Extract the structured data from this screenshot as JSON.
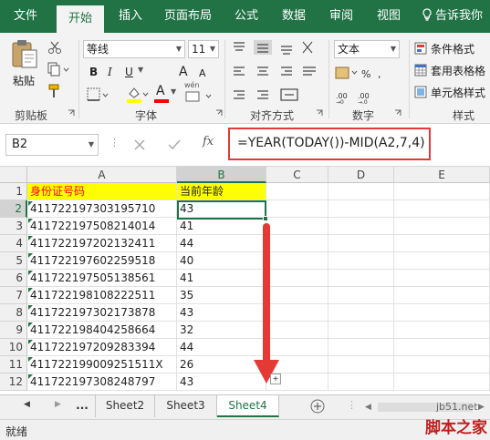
{
  "menu": {
    "tabs": [
      "文件",
      "开始",
      "插入",
      "页面布局",
      "公式",
      "数据",
      "审阅",
      "视图"
    ],
    "active": "开始",
    "tell_me": "告诉我你"
  },
  "ribbon": {
    "clipboard": {
      "paste": "粘贴",
      "label": "剪贴板"
    },
    "font": {
      "name": "等线",
      "size": "11",
      "bold": "B",
      "italic": "I",
      "underline": "U",
      "grow": "A",
      "shrink": "A",
      "color_letter": "A",
      "wen": "wén",
      "label": "字体"
    },
    "alignment": {
      "label": "对齐方式"
    },
    "number": {
      "format": "文本",
      "label": "数字"
    },
    "styles": {
      "cond_format": "条件格式",
      "table_format": "套用表格格",
      "cell_style": "单元格样式",
      "label": "样式"
    }
  },
  "formula_bar": {
    "name_box": "B2",
    "fx": "fx",
    "formula": "=YEAR(TODAY())-MID(A2,7,4)"
  },
  "grid": {
    "columns": [
      "A",
      "B",
      "C",
      "D",
      "E"
    ],
    "rows": [
      {
        "num": "1",
        "a": "身份证号码",
        "b": "当前年龄"
      },
      {
        "num": "2",
        "a": "411722197303195710",
        "b": "43"
      },
      {
        "num": "3",
        "a": "411722197508214014",
        "b": "41"
      },
      {
        "num": "4",
        "a": "411722197202132411",
        "b": "44"
      },
      {
        "num": "5",
        "a": "411722197602259518",
        "b": "40"
      },
      {
        "num": "6",
        "a": "411722197505138561",
        "b": "41"
      },
      {
        "num": "7",
        "a": "411722198108222511",
        "b": "35"
      },
      {
        "num": "8",
        "a": "411722197302173878",
        "b": "43"
      },
      {
        "num": "9",
        "a": "411722198404258664",
        "b": "32"
      },
      {
        "num": "10",
        "a": "411722197209283394",
        "b": "44"
      },
      {
        "num": "11",
        "a": "411722199009251511X",
        "b": "26"
      },
      {
        "num": "12",
        "a": "411722197308248797",
        "b": "43"
      }
    ]
  },
  "sheet_tabs": {
    "ellipsis": "...",
    "tabs": [
      "Sheet2",
      "Sheet3",
      "Sheet4"
    ],
    "active": "Sheet4"
  },
  "status": {
    "text": "就绪"
  },
  "watermark": {
    "line1": "jb51.net",
    "line2": "脚本之家"
  },
  "colors": {
    "excel_green": "#217346",
    "header_highlight": "#ffff00",
    "header_text": "#ff0000",
    "annotation_red": "#e53935"
  }
}
